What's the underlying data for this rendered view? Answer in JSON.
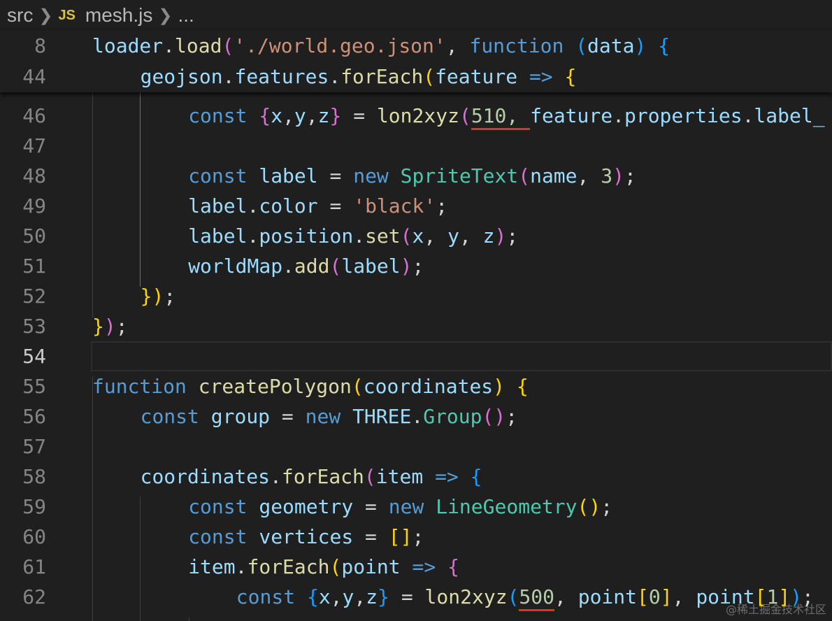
{
  "breadcrumb": {
    "folder": "src",
    "file_icon": "JS",
    "file": "mesh.js",
    "ellipsis": "..."
  },
  "sticky_lines": [
    {
      "num": "8",
      "tokens": [
        [
          "loader",
          "var"
        ],
        [
          ".",
          "def"
        ],
        [
          "load",
          "fn"
        ],
        [
          "(",
          "p2"
        ],
        [
          "'./world.geo.json'",
          "str"
        ],
        [
          ", ",
          "def"
        ],
        [
          "function",
          "kw"
        ],
        [
          " ",
          "def"
        ],
        [
          "(",
          "p3"
        ],
        [
          "data",
          "var"
        ],
        [
          ")",
          "p3"
        ],
        [
          " ",
          "def"
        ],
        [
          "{",
          "p3"
        ]
      ]
    },
    {
      "num": "44",
      "tokens": [
        [
          "geojson",
          "var"
        ],
        [
          ".",
          "def"
        ],
        [
          "features",
          "var"
        ],
        [
          ".",
          "def"
        ],
        [
          "forEach",
          "fn"
        ],
        [
          "(",
          "p1"
        ],
        [
          "feature",
          "var"
        ],
        [
          " ",
          "def"
        ],
        [
          "=>",
          "kw"
        ],
        [
          " ",
          "def"
        ],
        [
          "{",
          "p1"
        ]
      ]
    }
  ],
  "lines": [
    {
      "num": "46",
      "indent": 2,
      "tokens": [
        [
          "const",
          "kw"
        ],
        [
          " ",
          "def"
        ],
        [
          "{",
          "p2"
        ],
        [
          "x",
          "var"
        ],
        [
          ",",
          "def"
        ],
        [
          "y",
          "var"
        ],
        [
          ",",
          "def"
        ],
        [
          "z",
          "var"
        ],
        [
          "}",
          "p2"
        ],
        [
          " = ",
          "def"
        ],
        [
          "lon2xyz",
          "fn"
        ],
        [
          "(",
          "p2"
        ],
        [
          "510, ",
          "num",
          "u"
        ],
        [
          "feature",
          "var"
        ],
        [
          ".",
          "def"
        ],
        [
          "properties",
          "var"
        ],
        [
          ".",
          "def"
        ],
        [
          "label_",
          "var"
        ]
      ]
    },
    {
      "num": "47",
      "indent": 2,
      "tokens": []
    },
    {
      "num": "48",
      "indent": 2,
      "tokens": [
        [
          "const",
          "kw"
        ],
        [
          " ",
          "def"
        ],
        [
          "label",
          "var"
        ],
        [
          " = ",
          "def"
        ],
        [
          "new",
          "kw"
        ],
        [
          " ",
          "def"
        ],
        [
          "SpriteText",
          "cls"
        ],
        [
          "(",
          "p2"
        ],
        [
          "name",
          "var"
        ],
        [
          ", ",
          "def"
        ],
        [
          "3",
          "num"
        ],
        [
          ")",
          "p2"
        ],
        [
          ";",
          "def"
        ]
      ]
    },
    {
      "num": "49",
      "indent": 2,
      "tokens": [
        [
          "label",
          "var"
        ],
        [
          ".",
          "def"
        ],
        [
          "color",
          "var"
        ],
        [
          " = ",
          "def"
        ],
        [
          "'black'",
          "str"
        ],
        [
          ";",
          "def"
        ]
      ]
    },
    {
      "num": "50",
      "indent": 2,
      "tokens": [
        [
          "label",
          "var"
        ],
        [
          ".",
          "def"
        ],
        [
          "position",
          "var"
        ],
        [
          ".",
          "def"
        ],
        [
          "set",
          "fn"
        ],
        [
          "(",
          "p2"
        ],
        [
          "x",
          "var"
        ],
        [
          ", ",
          "def"
        ],
        [
          "y",
          "var"
        ],
        [
          ", ",
          "def"
        ],
        [
          "z",
          "var"
        ],
        [
          ")",
          "p2"
        ],
        [
          ";",
          "def"
        ]
      ]
    },
    {
      "num": "51",
      "indent": 2,
      "tokens": [
        [
          "worldMap",
          "var"
        ],
        [
          ".",
          "def"
        ],
        [
          "add",
          "fn"
        ],
        [
          "(",
          "p2"
        ],
        [
          "label",
          "var"
        ],
        [
          ")",
          "p2"
        ],
        [
          ";",
          "def"
        ]
      ]
    },
    {
      "num": "52",
      "indent": 1,
      "tokens": [
        [
          "}",
          "p1"
        ],
        [
          ")",
          "p1"
        ],
        [
          ";",
          "def"
        ]
      ]
    },
    {
      "num": "53",
      "indent": 0,
      "tokens": [
        [
          "}",
          "p1"
        ],
        [
          ")",
          "p2"
        ],
        [
          ";",
          "def"
        ]
      ]
    },
    {
      "num": "54",
      "indent": 0,
      "tokens": [],
      "active": true
    },
    {
      "num": "55",
      "indent": 0,
      "tokens": [
        [
          "function",
          "kw"
        ],
        [
          " ",
          "def"
        ],
        [
          "createPolygon",
          "fn"
        ],
        [
          "(",
          "p1"
        ],
        [
          "coordinates",
          "var"
        ],
        [
          ")",
          "p1"
        ],
        [
          " ",
          "def"
        ],
        [
          "{",
          "p1"
        ]
      ]
    },
    {
      "num": "56",
      "indent": 1,
      "tokens": [
        [
          "const",
          "kw"
        ],
        [
          " ",
          "def"
        ],
        [
          "group",
          "var"
        ],
        [
          " = ",
          "def"
        ],
        [
          "new",
          "kw"
        ],
        [
          " ",
          "def"
        ],
        [
          "THREE",
          "var"
        ],
        [
          ".",
          "def"
        ],
        [
          "Group",
          "cls"
        ],
        [
          "(",
          "p2"
        ],
        [
          ")",
          "p2"
        ],
        [
          ";",
          "def"
        ]
      ]
    },
    {
      "num": "57",
      "indent": 1,
      "tokens": []
    },
    {
      "num": "58",
      "indent": 1,
      "tokens": [
        [
          "coordinates",
          "var"
        ],
        [
          ".",
          "def"
        ],
        [
          "forEach",
          "fn"
        ],
        [
          "(",
          "p2"
        ],
        [
          "item",
          "var"
        ],
        [
          " ",
          "def"
        ],
        [
          "=>",
          "kw"
        ],
        [
          " ",
          "def"
        ],
        [
          "{",
          "p3"
        ]
      ]
    },
    {
      "num": "59",
      "indent": 2,
      "tokens": [
        [
          "const",
          "kw"
        ],
        [
          " ",
          "def"
        ],
        [
          "geometry",
          "var"
        ],
        [
          " = ",
          "def"
        ],
        [
          "new",
          "kw"
        ],
        [
          " ",
          "def"
        ],
        [
          "LineGeometry",
          "cls"
        ],
        [
          "(",
          "p1"
        ],
        [
          ")",
          "p1"
        ],
        [
          ";",
          "def"
        ]
      ]
    },
    {
      "num": "60",
      "indent": 2,
      "tokens": [
        [
          "const",
          "kw"
        ],
        [
          " ",
          "def"
        ],
        [
          "vertices",
          "var"
        ],
        [
          " = ",
          "def"
        ],
        [
          "[",
          "p1"
        ],
        [
          "]",
          "p1"
        ],
        [
          ";",
          "def"
        ]
      ]
    },
    {
      "num": "61",
      "indent": 2,
      "tokens": [
        [
          "item",
          "var"
        ],
        [
          ".",
          "def"
        ],
        [
          "forEach",
          "fn"
        ],
        [
          "(",
          "p1"
        ],
        [
          "point",
          "var"
        ],
        [
          " ",
          "def"
        ],
        [
          "=>",
          "kw"
        ],
        [
          " ",
          "def"
        ],
        [
          "{",
          "p2"
        ]
      ]
    },
    {
      "num": "62",
      "indent": 3,
      "tokens": [
        [
          "const",
          "kw"
        ],
        [
          " ",
          "def"
        ],
        [
          "{",
          "p3"
        ],
        [
          "x",
          "var"
        ],
        [
          ",",
          "def"
        ],
        [
          "y",
          "var"
        ],
        [
          ",",
          "def"
        ],
        [
          "z",
          "var"
        ],
        [
          "}",
          "p3"
        ],
        [
          " = ",
          "def"
        ],
        [
          "lon2xyz",
          "fn"
        ],
        [
          "(",
          "p3"
        ],
        [
          "500",
          "num",
          "u"
        ],
        [
          ", ",
          "def"
        ],
        [
          "point",
          "var"
        ],
        [
          "[",
          "p1"
        ],
        [
          "0",
          "num"
        ],
        [
          "]",
          "p1"
        ],
        [
          ", ",
          "def"
        ],
        [
          "point",
          "var"
        ],
        [
          "[",
          "p1"
        ],
        [
          "1",
          "num"
        ],
        [
          "]",
          "p1"
        ],
        [
          ")",
          "p3"
        ],
        [
          ";",
          "def"
        ]
      ]
    }
  ],
  "watermark": "@稀土掘金技术社区",
  "colors": {
    "background": "#1f1f1f",
    "keyword": "#569cd6",
    "variable": "#9cdcfe",
    "function": "#dcdcaa",
    "string": "#ce9178",
    "class": "#4ec9b0",
    "number": "#b5cea8",
    "underline": "#e0312b"
  }
}
